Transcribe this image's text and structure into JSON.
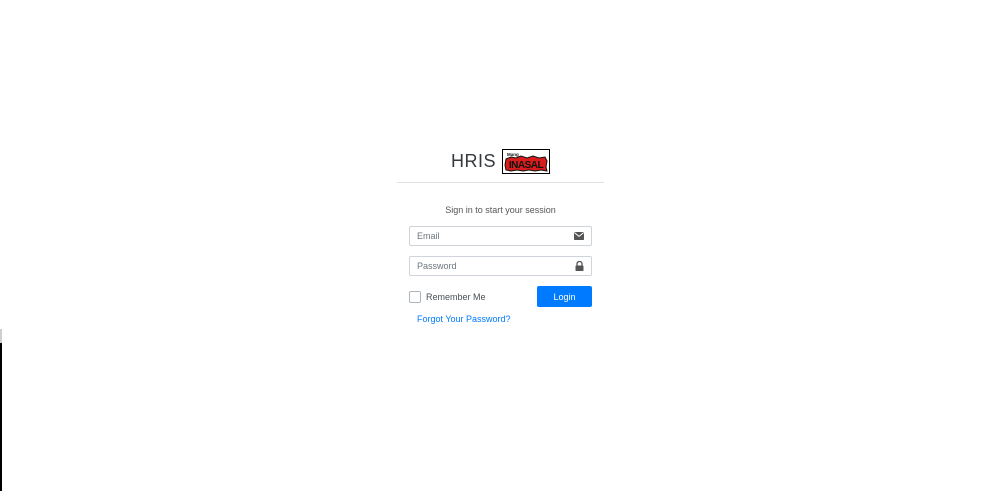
{
  "brand": {
    "title": "HRIS",
    "logo": {
      "icon": "mang-inasal-logo-icon",
      "text_top": "Mang",
      "text_main": "INASAL"
    }
  },
  "login": {
    "message": "Sign in to start your session",
    "email": {
      "placeholder": "Email",
      "value": "",
      "icon": "envelope-icon"
    },
    "password": {
      "placeholder": "Password",
      "value": "",
      "icon": "lock-icon"
    },
    "remember_label": "Remember Me",
    "remember_checked": false,
    "login_label": "Login",
    "forgot_label": "Forgot Your Password?"
  },
  "colors": {
    "primary": "#007bff",
    "border": "#ced4da",
    "text": "#495057",
    "logo_red": "#d91c1c"
  }
}
